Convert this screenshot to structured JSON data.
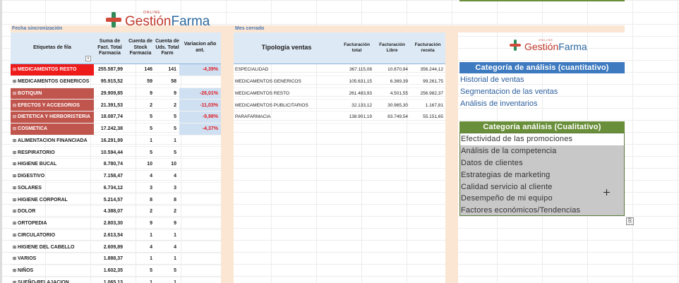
{
  "logo": {
    "online": "ONLINE",
    "brand_a": "Gestión",
    "brand_b": "Farma"
  },
  "labels": {
    "sync_date": "Fecha sincronización",
    "month_closed": "Mes cerrado"
  },
  "pivot": {
    "headers": [
      "Etiquetas de fila",
      "Suma de Fact. Total Farmacia",
      "Cuenta de Stock Farmacia",
      "Cuenta de Uds. Total Farm",
      "Variacion año ant."
    ],
    "rows": [
      {
        "label": "MEDICAMENTOS RESTO",
        "exp": "⊟",
        "total": "255.587,99",
        "stock": "146",
        "uds": "141",
        "var": "-4,39%",
        "style": "red"
      },
      {
        "label": "MEDICAMENTOS GENERICOS",
        "exp": "⊞",
        "total": "95.915,52",
        "stock": "59",
        "uds": "58",
        "var": "",
        "style": "plain"
      },
      {
        "label": "BOTIQUIN",
        "exp": "⊟",
        "total": "29.909,85",
        "stock": "9",
        "uds": "9",
        "var": "-26,01%",
        "style": "brick"
      },
      {
        "label": "EFECTOS Y ACCESORIOS",
        "exp": "⊟",
        "total": "21.391,53",
        "stock": "2",
        "uds": "2",
        "var": "-11,03%",
        "style": "brick"
      },
      {
        "label": "DIETETICA Y HERBORISTERIA",
        "exp": "⊟",
        "total": "18.087,74",
        "stock": "5",
        "uds": "5",
        "var": "-9,98%",
        "style": "brick"
      },
      {
        "label": "COSMETICA",
        "exp": "⊟",
        "total": "17.242,38",
        "stock": "5",
        "uds": "5",
        "var": "-4,37%",
        "style": "brick"
      },
      {
        "label": "ALIMENTACION FINANCIADA",
        "exp": "⊞",
        "total": "16.291,99",
        "stock": "1",
        "uds": "1",
        "var": "",
        "style": "plain"
      },
      {
        "label": "RESPIRATORIO",
        "exp": "⊞",
        "total": "10.594,44",
        "stock": "5",
        "uds": "5",
        "var": "",
        "style": "plain"
      },
      {
        "label": "HIGIENE BUCAL",
        "exp": "⊞",
        "total": "8.780,74",
        "stock": "10",
        "uds": "10",
        "var": "",
        "style": "plain"
      },
      {
        "label": "DIGESTIVO",
        "exp": "⊞",
        "total": "7.158,47",
        "stock": "4",
        "uds": "4",
        "var": "",
        "style": "plain"
      },
      {
        "label": "SOLARES",
        "exp": "⊞",
        "total": "6.734,12",
        "stock": "3",
        "uds": "3",
        "var": "",
        "style": "plain"
      },
      {
        "label": "HIGIENE CORPORAL",
        "exp": "⊞",
        "total": "5.214,57",
        "stock": "8",
        "uds": "8",
        "var": "",
        "style": "plain"
      },
      {
        "label": "DOLOR",
        "exp": "⊞",
        "total": "4.388,07",
        "stock": "2",
        "uds": "2",
        "var": "",
        "style": "plain"
      },
      {
        "label": "ORTOPEDIA",
        "exp": "⊞",
        "total": "2.803,30",
        "stock": "9",
        "uds": "9",
        "var": "",
        "style": "plain"
      },
      {
        "label": "CIRCULATORIO",
        "exp": "⊞",
        "total": "2.613,54",
        "stock": "1",
        "uds": "1",
        "var": "",
        "style": "plain"
      },
      {
        "label": "HIGIENE DEL CABELLO",
        "exp": "⊞",
        "total": "2.609,89",
        "stock": "4",
        "uds": "4",
        "var": "",
        "style": "plain"
      },
      {
        "label": "VARIOS",
        "exp": "⊞",
        "total": "1.888,37",
        "stock": "1",
        "uds": "1",
        "var": "",
        "style": "plain"
      },
      {
        "label": "NIÑOS",
        "exp": "⊞",
        "total": "1.602,35",
        "stock": "5",
        "uds": "5",
        "var": "",
        "style": "plain"
      },
      {
        "label": "SUEÑO-RELAJACION",
        "exp": "⊞",
        "total": "1.065,13",
        "stock": "1",
        "uds": "1",
        "var": "",
        "style": "plain"
      }
    ]
  },
  "mid": {
    "headers": [
      "Tipología ventas",
      "Facturación total",
      "Facturación Libre",
      "Facturación receta"
    ],
    "rows": [
      {
        "label": "ESPECIALIDAD",
        "total": "367.115,08",
        "libre": "10.870,94",
        "receta": "356.244,12"
      },
      {
        "label": "MEDICAMENTOS GENERICOS",
        "total": "105.631,15",
        "libre": "6.369,39",
        "receta": "99.261,75"
      },
      {
        "label": "MEDICAMENTOS RESTO",
        "total": "261.483,93",
        "libre": "4.501,55",
        "receta": "256.982,37"
      },
      {
        "label": "MEDICAMENTOS PUBLICITARIOS",
        "total": "32.133,12",
        "libre": "30.965,30",
        "receta": "1.167,81"
      },
      {
        "label": "PARAFARMACIA",
        "total": "138.901,19",
        "libre": "83.749,54",
        "receta": "55.151,65"
      }
    ]
  },
  "quant": {
    "title": "Categoría de análisis  (cuantitativo)",
    "items": [
      "Historial de ventas",
      "Segmentacion de las ventas",
      "Análisis de inventarios"
    ]
  },
  "qual": {
    "title": "Categoría análisis  (Cualitativo)",
    "items": [
      "Efectividad de las promociones",
      "Análisis de la competencia",
      "Datos de clientes",
      "Estrategias de marketing",
      "Calidad servicio al cliente",
      "Desempeño de mi equipo",
      "Factores económicos/Tendencias"
    ]
  },
  "colors": {
    "accent_blue": "#3d7abf",
    "accent_green": "#6a8f3a",
    "highlight_red": "#ee1b1b",
    "highlight_brick": "#c0554d",
    "negative_text": "#e01b24"
  }
}
